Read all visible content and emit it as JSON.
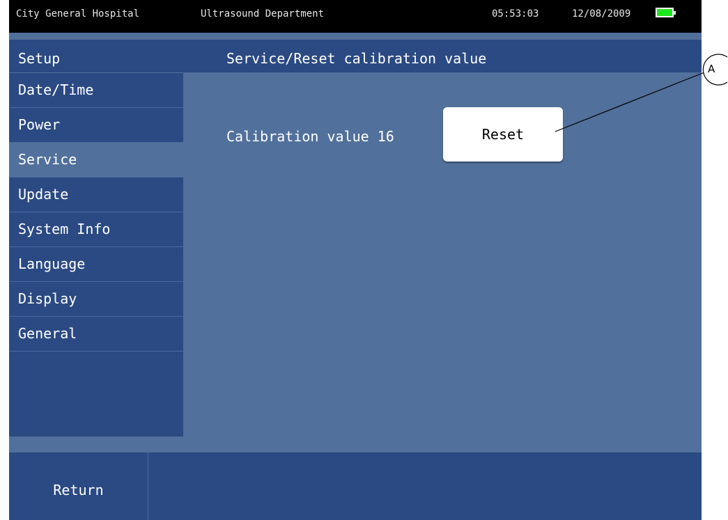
{
  "status_bar": {
    "hospital": "City General Hospital",
    "department": "Ultrasound Department",
    "time": "05:53:03",
    "date": "12/08/2009",
    "battery_icon": "battery-full-icon",
    "battery_color": "#1ee61e"
  },
  "sidebar": {
    "title": "Setup",
    "items": [
      {
        "label": "Date/Time"
      },
      {
        "label": "Power"
      },
      {
        "label": "Service"
      },
      {
        "label": "Update"
      },
      {
        "label": "System Info"
      },
      {
        "label": "Language"
      },
      {
        "label": "Display"
      },
      {
        "label": "General"
      }
    ],
    "active": "Service"
  },
  "panel": {
    "title": "Service/Reset calibration value",
    "calibration_label": "Calibration value",
    "calibration_value": "16",
    "reset_label": "Reset"
  },
  "footer": {
    "return_label": "Return"
  },
  "callout": {
    "letter": "A"
  },
  "colors": {
    "background": "#51709b",
    "menu_bg": "#2b4a83",
    "status_bg": "#000000"
  }
}
